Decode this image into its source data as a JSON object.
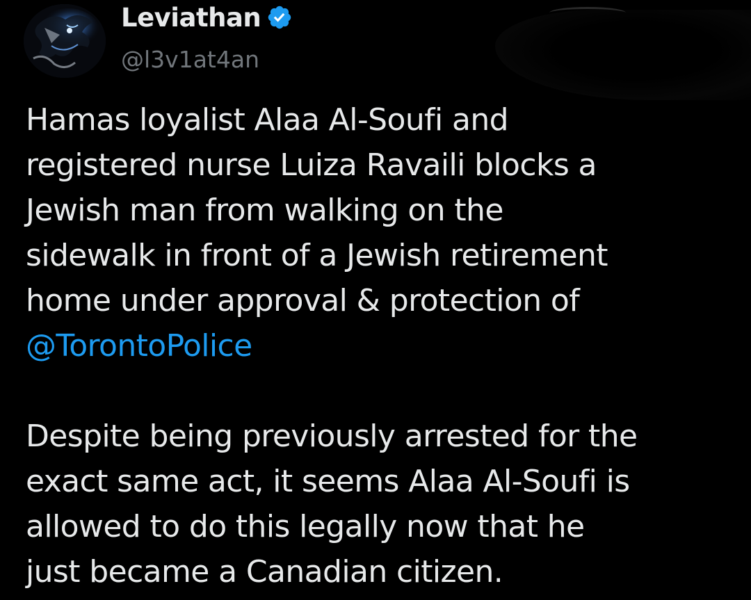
{
  "author": {
    "display_name": "Leviathan",
    "handle": "@l3v1at4an",
    "verified": true,
    "verified_icon": "verified-badge-icon",
    "avatar": "creature-avatar"
  },
  "tweet": {
    "paragraph1": [
      "Hamas loyalist Alaa Al-Soufi and",
      "registered nurse Luiza Ravaili blocks a",
      "Jewish man from walking on the",
      "sidewalk in front of a Jewish retirement",
      "home under approval & protection of"
    ],
    "mention": "@TorontoPolice",
    "paragraph2": [
      "Despite being previously arrested for the",
      "exact same act, it seems Alaa Al-Soufi is",
      "allowed to do this legally now that he",
      "just became a Canadian citizen."
    ]
  },
  "colors": {
    "background": "#000000",
    "text": "#e7e9ea",
    "secondary_text": "#71767b",
    "link": "#1d9bf0",
    "verified": "#1d9bf0"
  }
}
